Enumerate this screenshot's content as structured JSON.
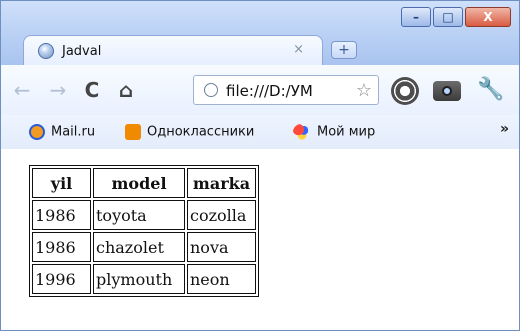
{
  "browser": {
    "tab": {
      "title": "Jadval",
      "close_glyph": "×"
    },
    "new_tab_glyph": "+",
    "window_controls": {
      "minimize": "–",
      "maximize": "□",
      "close": "X"
    },
    "toolbar": {
      "url": "file:///D:/УМ",
      "icons": [
        "back-arrow-icon",
        "forward-arrow-icon",
        "reload-icon",
        "home-icon",
        "star-icon",
        "mail-extension-icon",
        "camera-icon",
        "wrench-icon"
      ]
    },
    "bookmarks": [
      {
        "label": "Mail.ru",
        "icon": "mail-ru-icon"
      },
      {
        "label": "Одноклассники",
        "icon": "odnoklassniki-icon"
      },
      {
        "label": "Мой мир",
        "icon": "moi-mir-icon"
      }
    ],
    "bookmarks_more": "»"
  },
  "page": {
    "table": {
      "headers": [
        "yil",
        "model",
        "marka"
      ],
      "rows": [
        [
          "1986",
          "toyota",
          "cozolla"
        ],
        [
          "1986",
          "chazolet",
          "nova"
        ],
        [
          "1996",
          "plymouth",
          "neon"
        ]
      ]
    }
  }
}
